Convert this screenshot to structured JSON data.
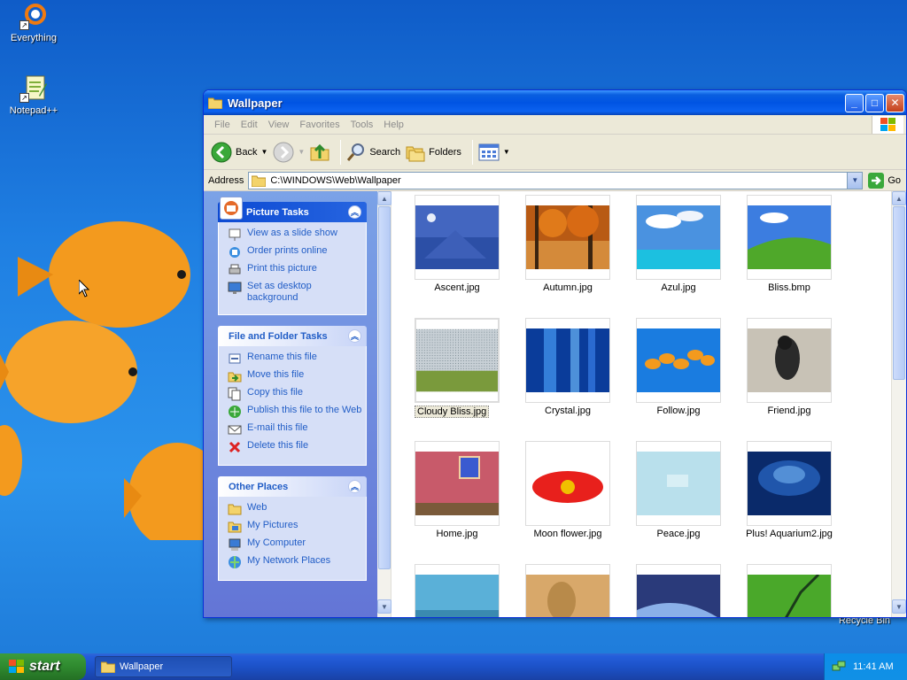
{
  "desktop": {
    "icons": [
      {
        "label": "Everything"
      },
      {
        "label": "Notepad++"
      }
    ],
    "recycle_bin_label": "Recycle Bin"
  },
  "window": {
    "title": "Wallpaper",
    "controls": {
      "minimize": "_",
      "maximize": "□",
      "close": "✕"
    },
    "menu": [
      "File",
      "Edit",
      "View",
      "Favorites",
      "Tools",
      "Help"
    ],
    "toolbar": {
      "back": "Back",
      "search": "Search",
      "folders": "Folders"
    },
    "address": {
      "label": "Address",
      "value": "C:\\WINDOWS\\Web\\Wallpaper",
      "go": "Go"
    },
    "task_pane": {
      "picture_tasks": {
        "title": "Picture Tasks",
        "items": [
          "View as a slide show",
          "Order prints online",
          "Print this picture",
          "Set as desktop background"
        ]
      },
      "file_folder_tasks": {
        "title": "File and Folder Tasks",
        "items": [
          "Rename this file",
          "Move this file",
          "Copy this file",
          "Publish this file to the Web",
          "E-mail this file",
          "Delete this file"
        ]
      },
      "other_places": {
        "title": "Other Places",
        "items": [
          "Web",
          "My Pictures",
          "My Computer",
          "My Network Places"
        ]
      }
    },
    "files": [
      {
        "name": "Ascent.jpg"
      },
      {
        "name": "Autumn.jpg"
      },
      {
        "name": "Azul.jpg"
      },
      {
        "name": "Bliss.bmp"
      },
      {
        "name": "Cloudy Bliss.jpg",
        "selected": true
      },
      {
        "name": "Crystal.jpg"
      },
      {
        "name": "Follow.jpg"
      },
      {
        "name": "Friend.jpg"
      },
      {
        "name": "Home.jpg"
      },
      {
        "name": "Moon flower.jpg"
      },
      {
        "name": "Peace.jpg"
      },
      {
        "name": "Plus! Aquarium2.jpg"
      }
    ]
  },
  "taskbar": {
    "start_label": "start",
    "task_button": "Wallpaper",
    "clock": "11:41 AM"
  }
}
